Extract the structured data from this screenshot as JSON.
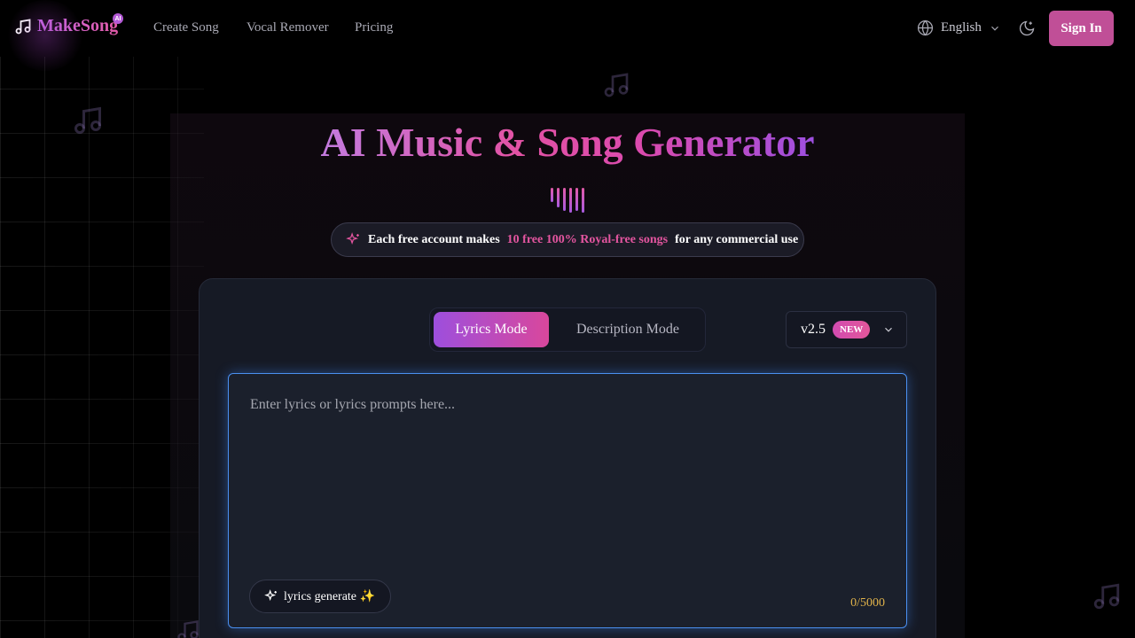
{
  "brand": {
    "name": "MakeSong",
    "badge": "AI"
  },
  "nav": {
    "items": [
      "Create Song",
      "Vocal Remover",
      "Pricing"
    ]
  },
  "header": {
    "language": "English",
    "signin_label": "Sign In"
  },
  "hero": {
    "title": "AI Music & Song Generator",
    "promo_prefix": "Each free account makes",
    "promo_highlight": "10 free 100% Royal-free songs",
    "promo_suffix": "for any commercial use"
  },
  "generator": {
    "modes": [
      "Lyrics Mode",
      "Description Mode"
    ],
    "active_mode": "Lyrics Mode",
    "version": "v2.5",
    "version_badge": "NEW",
    "lyrics_placeholder": "Enter lyrics or lyrics prompts here...",
    "lyrics_value": "",
    "generate_label": "lyrics generate ✨",
    "char_count": "0/5000"
  },
  "icons": {
    "logo": "music-note-icon",
    "language": "globe-icon",
    "theme": "moon-icon",
    "promo": "sparkles-icon",
    "generate": "sparkles-icon",
    "version_dropdown": "chevron-down-icon"
  },
  "colors": {
    "accent_pink": "#e3559f",
    "accent_purple": "#9d4fdd",
    "signin_bg": "#c04f97",
    "input_border": "#4a8ff0",
    "counter": "#e0b24a"
  }
}
